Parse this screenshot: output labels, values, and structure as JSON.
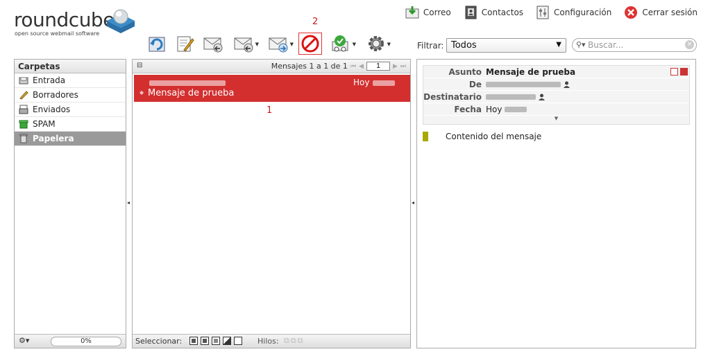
{
  "logo": {
    "wordmark": "roundcube",
    "tagline": "open source webmail software"
  },
  "topnav": {
    "mail": "Correo",
    "contacts": "Contactos",
    "settings": "Configuración",
    "logout": "Cerrar sesión"
  },
  "annotations": {
    "two": "2",
    "one": "1"
  },
  "filter": {
    "label": "Filtrar:",
    "value": "Todos"
  },
  "search": {
    "placeholder": "Buscar..."
  },
  "folders": {
    "title": "Carpetas",
    "items": [
      {
        "label": "Entrada",
        "icon": "inbox-icon"
      },
      {
        "label": "Borradores",
        "icon": "pencil-icon"
      },
      {
        "label": "Enviados",
        "icon": "sent-icon"
      },
      {
        "label": "SPAM",
        "icon": "spam-icon"
      },
      {
        "label": "Papelera",
        "icon": "trash-icon"
      }
    ],
    "quota": "0%"
  },
  "messages": {
    "pager_text": "Mensajes 1 a 1 de 1",
    "page": "1",
    "row": {
      "date": "Hoy",
      "subject": "Mensaje de prueba"
    },
    "footer": {
      "select_label": "Seleccionar:",
      "threads_label": "Hilos:"
    }
  },
  "preview": {
    "subject_label": "Asunto",
    "subject_value": "Mensaje de prueba",
    "from_label": "De",
    "to_label": "Destinatario",
    "date_label": "Fecha",
    "date_value": "Hoy",
    "body": "Contenido del mensaje"
  },
  "colors": {
    "selected_row": "#d32f2f",
    "selected_folder": "#9a9a9a",
    "annotation": "#cc1a1a",
    "body_marker": "#a8a800"
  }
}
